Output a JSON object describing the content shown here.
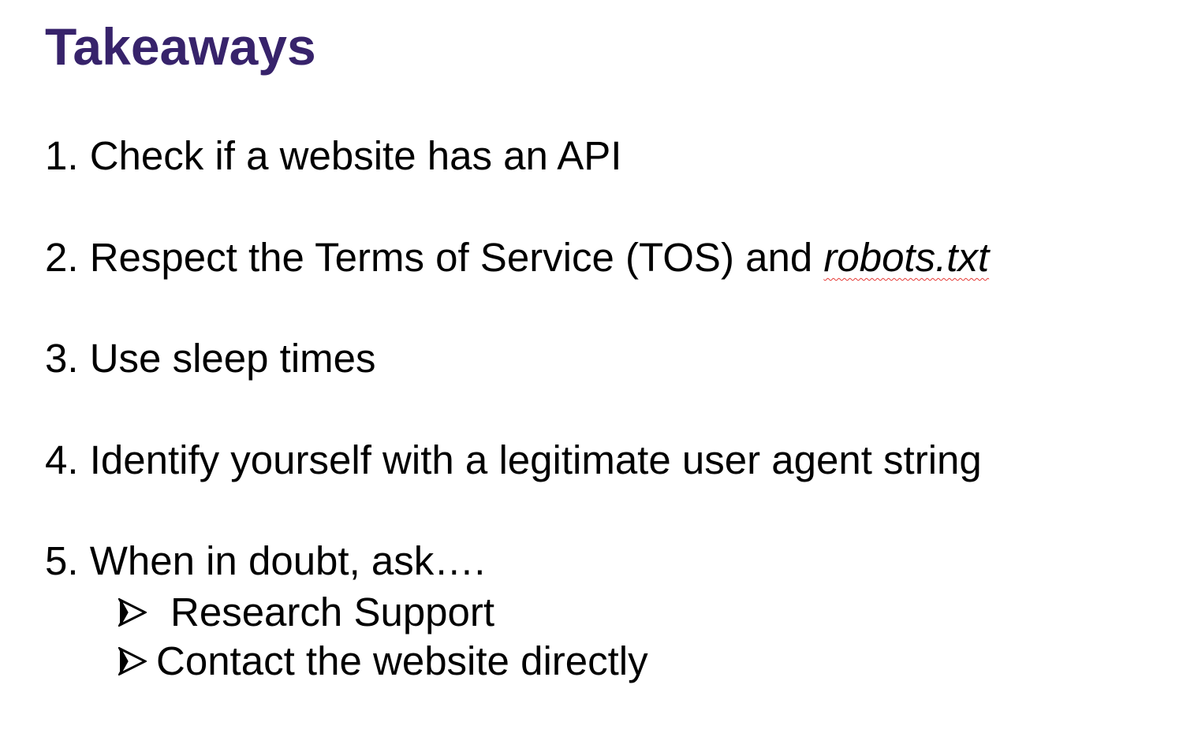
{
  "colors": {
    "title": "#37236b",
    "text": "#000000",
    "spellcheck_underline": "#e53935"
  },
  "title": "Takeaways",
  "items": [
    {
      "text": "1. Check if a website has an API"
    },
    {
      "text": "2. Respect the Terms of Service (TOS) and ",
      "emphasis": "robots.txt"
    },
    {
      "text": "3. Use sleep times"
    },
    {
      "text": "4. Identify yourself with a legitimate user agent string"
    },
    {
      "text": "5. When in doubt, ask…."
    }
  ],
  "subitems": [
    {
      "icon": "arrow-bullet-icon",
      "text": "Research Support"
    },
    {
      "icon": "arrow-bullet-icon",
      "text": "Contact the website directly"
    }
  ]
}
